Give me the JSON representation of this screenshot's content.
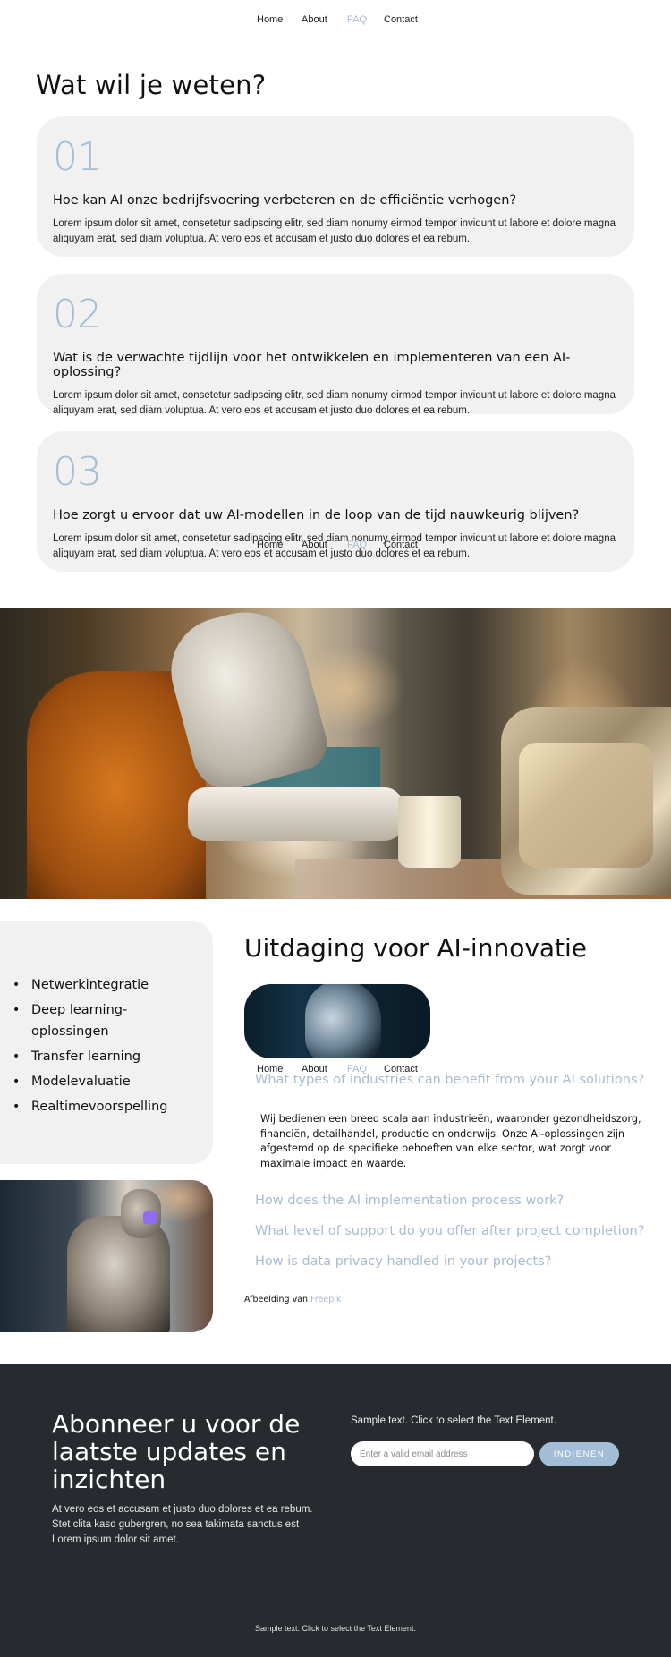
{
  "nav": {
    "items": [
      {
        "label": "Home",
        "active": false
      },
      {
        "label": "About",
        "active": false
      },
      {
        "label": "FAQ",
        "active": true
      },
      {
        "label": "Contact",
        "active": false
      }
    ]
  },
  "faq": {
    "title": "Wat wil je weten?",
    "cards": [
      {
        "number": "01",
        "question": "Hoe kan AI onze bedrijfsvoering verbeteren en de efficiëntie verhogen?",
        "answer": "Lorem ipsum dolor sit amet, consetetur sadipscing elitr, sed diam nonumy eirmod tempor invidunt ut labore et dolore magna aliquyam erat, sed diam voluptua. At vero eos et accusam et justo duo dolores et ea rebum."
      },
      {
        "number": "02",
        "question": "Wat is de verwachte tijdlijn voor het ontwikkelen en implementeren van een AI-oplossing?",
        "answer": "Lorem ipsum dolor sit amet, consetetur sadipscing elitr, sed diam nonumy eirmod tempor invidunt ut labore et dolore magna aliquyam erat, sed diam voluptua. At vero eos et accusam et justo duo dolores et ea rebum."
      },
      {
        "number": "03",
        "question": "Hoe zorgt u ervoor dat uw AI-modellen in de loop van de tijd nauwkeurig blijven?",
        "answer": "Lorem ipsum dolor sit amet, consetetur sadipscing elitr, sed diam nonumy eirmod tempor invidunt ut labore et dolore magna aliquyam erat, sed diam voluptua. At vero eos et accusam et justo duo dolores et ea rebum."
      }
    ]
  },
  "images": {
    "hero_alt": "Robot working at a kitchen counter",
    "robot_phone_alt": "Robot holding a phone",
    "robot_face_alt": "Cyborg face"
  },
  "features": {
    "items": [
      "Netwerkintegratie",
      "Deep learning-oplossingen",
      "Transfer learning",
      "Modelevaluatie",
      "Realtimevoorspelling"
    ]
  },
  "challenge": {
    "title": "Uitdaging voor AI-innovatie",
    "accordion": [
      {
        "question": "What types of industries can benefit from your AI solutions?",
        "answer": "Wij bedienen een breed scala aan industrieën, waaronder gezondheidszorg, financiën, detailhandel, productie en onderwijs. Onze AI-oplossingen zijn afgestemd op de specifieke behoeften van elke sector, wat zorgt voor maximale impact en waarde.",
        "expanded": true
      },
      {
        "question": "How does the AI implementation process work?",
        "expanded": false
      },
      {
        "question": "What level of support do you offer after project completion?",
        "expanded": false
      },
      {
        "question": "How is data privacy handled in your projects?",
        "expanded": false
      }
    ],
    "credit_prefix": "Afbeelding van",
    "credit_link": "Freepik"
  },
  "subscribe": {
    "title": "Abonneer u voor de laatste updates en inzichten",
    "text": "At vero eos et accusam et justo duo dolores et ea rebum. Stet clita kasd gubergren, no sea takimata sanctus est Lorem ipsum dolor sit amet.",
    "sample_text": "Sample text. Click to select the Text Element.",
    "email_placeholder": "Enter a valid email address",
    "email_value": "",
    "submit_label": "INDIENEN"
  },
  "footer": {
    "sample_text": "Sample text. Click to select the Text Element."
  },
  "colors": {
    "accent": "#a4bdd6",
    "footer_bg": "#272b30",
    "card_bg": "#f1f1f1"
  }
}
